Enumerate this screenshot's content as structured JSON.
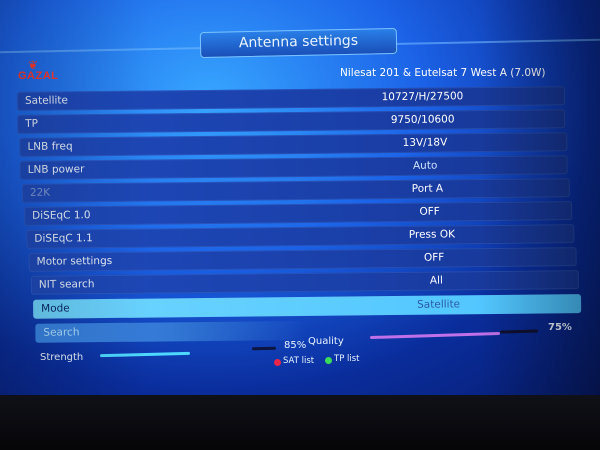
{
  "window": {
    "title": "Antenna settings"
  },
  "brand": {
    "logo_text": "GAZAL"
  },
  "satellite_value": "Nilesat 201 & Eutelsat 7 West A (7.0W)",
  "rows": [
    {
      "label": "Satellite",
      "value": ""
    },
    {
      "label": "TP",
      "value": "10727/H/27500"
    },
    {
      "label": "LNB freq",
      "value": "9750/10600"
    },
    {
      "label": "LNB power",
      "value": "13V/18V"
    },
    {
      "label": "22K",
      "value": "Auto"
    },
    {
      "label": "DiSEqC 1.0",
      "value": "Port A"
    },
    {
      "label": "DiSEqC 1.1",
      "value": "OFF"
    },
    {
      "label": "Motor settings",
      "value": "Press OK"
    },
    {
      "label": "NIT search",
      "value": "OFF"
    },
    {
      "label": "Mode",
      "value": "All"
    },
    {
      "label": "Search",
      "value": "Satellite"
    }
  ],
  "signal": {
    "strength_label": "Strength",
    "strength_value": "85%",
    "strength_fraction": 0.85,
    "quality_label": "Quality",
    "quality_value": "75%",
    "quality_fraction": 0.75
  },
  "legend": {
    "sat_list": "SAT list",
    "tp_list": "TP list"
  },
  "colors": {
    "accent": "#1c63e8",
    "highlight": "#4cc3ff",
    "red_key": "#e8264a",
    "green_key": "#3bdc5a"
  }
}
